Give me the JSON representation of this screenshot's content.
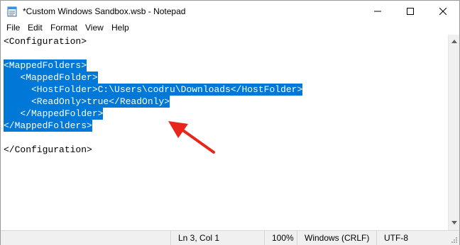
{
  "window": {
    "title": "*Custom Windows Sandbox.wsb - Notepad"
  },
  "menu": {
    "items": [
      "File",
      "Edit",
      "Format",
      "View",
      "Help"
    ]
  },
  "editor": {
    "lines": [
      "<Configuration>",
      "",
      "<MappedFolders>",
      "   <MappedFolder>",
      "     <HostFolder>C:\\Users\\codru\\Downloads</HostFolder>",
      "     <ReadOnly>true</ReadOnly>",
      "   </MappedFolder>",
      "</MappedFolders>",
      "",
      "</Configuration>"
    ],
    "selection_color": "#0078d7"
  },
  "annotation": {
    "arrow_color": "#e8261c"
  },
  "status": {
    "position": "Ln 3, Col 1",
    "zoom": "100%",
    "line_endings": "Windows (CRLF)",
    "encoding": "UTF-8"
  },
  "icons": {
    "app": "notepad-icon",
    "minimize": "minimize-icon",
    "maximize": "maximize-icon",
    "close": "close-icon"
  }
}
